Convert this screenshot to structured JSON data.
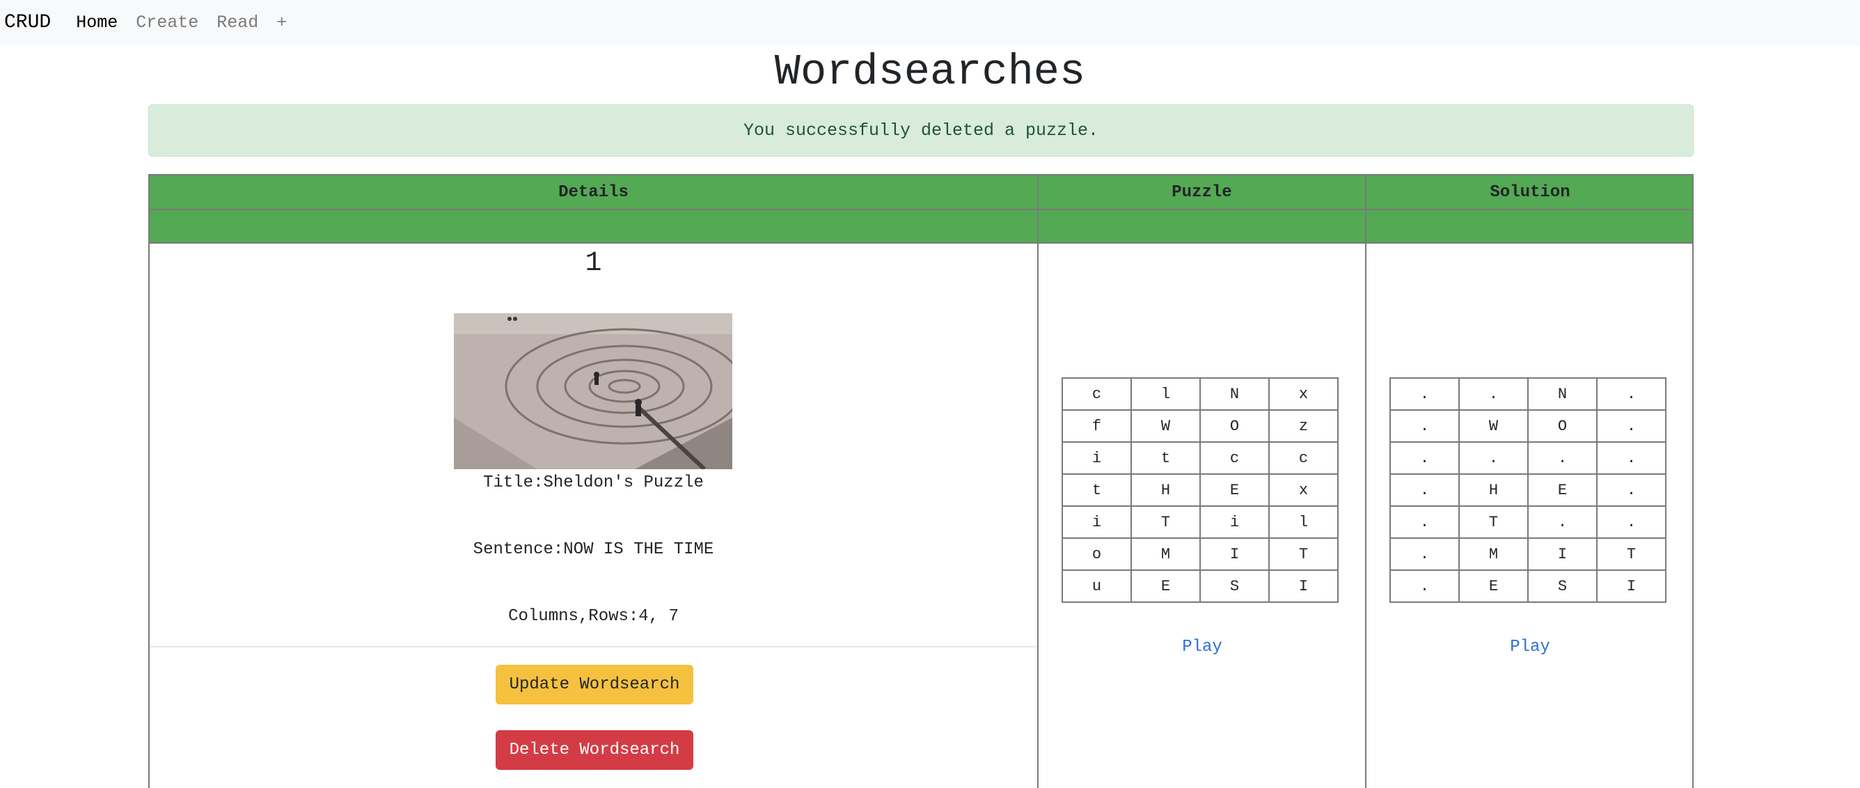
{
  "nav": {
    "brand": "CRUD",
    "items": [
      {
        "label": "Home",
        "active": true
      },
      {
        "label": "Create",
        "active": false
      },
      {
        "label": "Read",
        "active": false
      },
      {
        "label": "+",
        "active": false
      }
    ]
  },
  "page_title": "Wordsearches",
  "alert": {
    "message": "You successfully deleted a puzzle."
  },
  "table": {
    "headers": [
      "Details",
      "Puzzle",
      "Solution"
    ],
    "header_color": "#54a954"
  },
  "item": {
    "number": "1",
    "image_alt": "Spiral sand art on beach",
    "title_line": "Title:Sheldon's Puzzle",
    "sentence_line": "Sentence:NOW IS THE TIME",
    "dims_line": "Columns,Rows:4, 7",
    "update_label": "Update Wordsearch",
    "delete_label": "Delete Wordsearch",
    "puzzle_grid": [
      [
        "c",
        "l",
        "N",
        "x"
      ],
      [
        "f",
        "W",
        "O",
        "z"
      ],
      [
        "i",
        "t",
        "c",
        "c"
      ],
      [
        "t",
        "H",
        "E",
        "x"
      ],
      [
        "i",
        "T",
        "i",
        "l"
      ],
      [
        "o",
        "M",
        "I",
        "T"
      ],
      [
        "u",
        "E",
        "S",
        "I"
      ]
    ],
    "solution_grid": [
      [
        ".",
        ".",
        "N",
        "."
      ],
      [
        ".",
        "W",
        "O",
        "."
      ],
      [
        ".",
        ".",
        ".",
        "."
      ],
      [
        ".",
        "H",
        "E",
        "."
      ],
      [
        ".",
        "T",
        ".",
        "."
      ],
      [
        ".",
        "M",
        "I",
        "T"
      ],
      [
        ".",
        "E",
        "S",
        "I"
      ]
    ],
    "puzzle_play_label": "Play",
    "solution_play_label": "Play"
  },
  "colors": {
    "warning": "#f6c13f",
    "danger": "#d43c45",
    "link": "#2a6fd6",
    "alert_bg": "#d9ecdc"
  }
}
